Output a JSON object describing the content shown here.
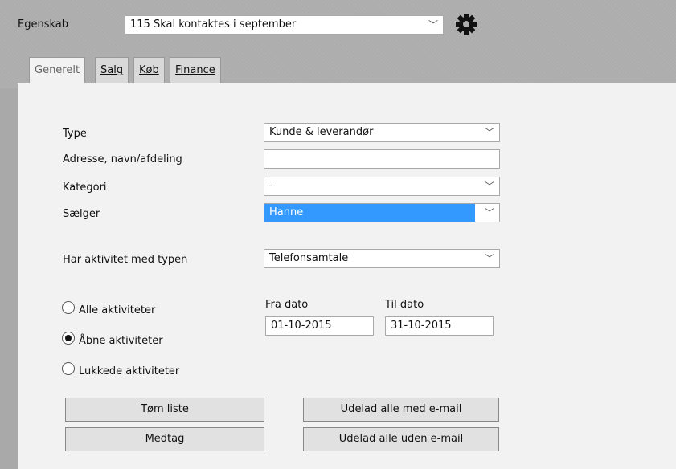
{
  "header": {
    "property_label": "Egenskab",
    "property_value": "115 Skal kontaktes i september",
    "settings_icon": "gear-icon"
  },
  "tabs": [
    {
      "label": "Generelt",
      "active": true
    },
    {
      "label": "Salg",
      "active": false
    },
    {
      "label": "Køb",
      "active": false
    },
    {
      "label": "Finance",
      "active": false
    }
  ],
  "form": {
    "type_label": "Type",
    "type_value": "Kunde & leverandør",
    "address_label": "Adresse, navn/afdeling",
    "address_value": "",
    "category_label": "Kategori",
    "category_value": "-",
    "seller_label": "Sælger",
    "seller_value": "Hanne",
    "activity_type_label": "Har aktivitet med typen",
    "activity_type_value": "Telefonsamtale"
  },
  "activities": {
    "options": [
      {
        "label": "Alle aktiviteter",
        "checked": false
      },
      {
        "label": "Åbne aktiviteter",
        "checked": true
      },
      {
        "label": "Lukkede aktiviteter",
        "checked": false
      }
    ],
    "from_label": "Fra dato",
    "from_value": "01-10-2015",
    "to_label": "Til dato",
    "to_value": "31-10-2015"
  },
  "buttons": {
    "clear": "Tøm liste",
    "include": "Medtag",
    "exclude_with_email": "Udelad alle med e-mail",
    "exclude_without_email": "Udelad alle uden e-mail"
  }
}
